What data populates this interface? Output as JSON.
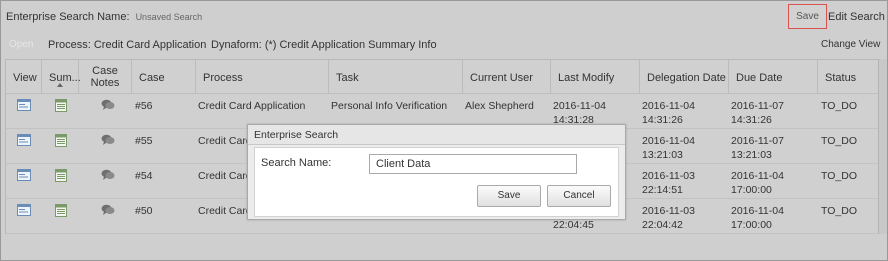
{
  "header": {
    "title_label": "Enterprise Search Name:",
    "search_name_value": "Unsaved Search",
    "save_label": "Save",
    "edit_search_label": "Edit Search"
  },
  "infobar": {
    "open_label": "Open",
    "process_label": "Process:",
    "process_value": "Credit Card Application",
    "dynaform_label": "Dynaform:",
    "dynaform_value": "(*) Credit Application Summary Info",
    "change_view_label": "Change View"
  },
  "table": {
    "columns": [
      "View",
      "Sum...",
      "Case Notes",
      "Case",
      "Process",
      "Task",
      "Current User",
      "Last Modify",
      "Delegation Date",
      "Due Date",
      "Status"
    ],
    "rows": [
      {
        "case": "#56",
        "process": "Credit Card Application",
        "task": "Personal Info Verification",
        "user": "Alex Shepherd",
        "last_modify_date": "2016-11-04",
        "last_modify_time": "14:31:28",
        "delegation_date": "2016-11-04",
        "delegation_time": "14:31:26",
        "due_date": "2016-11-07",
        "due_time": "14:31:26",
        "status": "TO_DO"
      },
      {
        "case": "#55",
        "process": "Credit Card Application",
        "task": "",
        "user": "",
        "last_modify_date": "",
        "last_modify_time": "",
        "delegation_date": "2016-11-04",
        "delegation_time": "13:21:03",
        "due_date": "2016-11-07",
        "due_time": "13:21:03",
        "status": "TO_DO"
      },
      {
        "case": "#54",
        "process": "Credit Card",
        "task": "",
        "user": "",
        "last_modify_date": "",
        "last_modify_time": "",
        "delegation_date": "2016-11-03",
        "delegation_time": "22:14:51",
        "due_date": "2016-11-04",
        "due_time": "17:00:00",
        "status": "TO_DO"
      },
      {
        "case": "#50",
        "process": "Credit Card",
        "task": "",
        "user": "",
        "last_modify_date": "",
        "last_modify_time": "22:04:45",
        "delegation_date": "2016-11-03",
        "delegation_time": "22:04:42",
        "due_date": "2016-11-04",
        "due_time": "17:00:00",
        "status": "TO_DO"
      }
    ]
  },
  "dialog": {
    "title": "Enterprise Search",
    "label": "Search Name:",
    "input_value": "Client Data",
    "save_label": "Save",
    "cancel_label": "Cancel"
  },
  "colors": {
    "background": "#cfcfcf",
    "save_highlight_border": "#d9534f",
    "dialog_bg": "#ececec"
  }
}
